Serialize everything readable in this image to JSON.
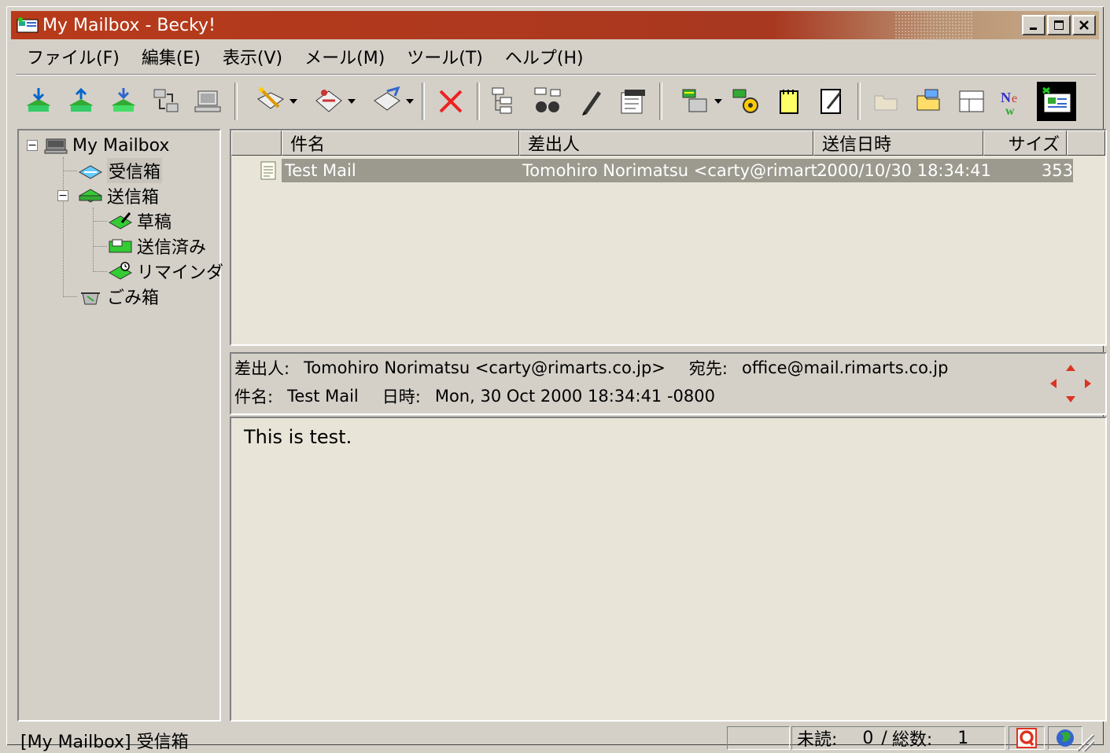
{
  "window": {
    "title": "My Mailbox - Becky!"
  },
  "menu": [
    "ファイル(F)",
    "編集(E)",
    "表示(V)",
    "メール(M)",
    "ツール(T)",
    "ヘルプ(H)"
  ],
  "tree": {
    "root": "My Mailbox",
    "inbox": "受信箱",
    "outbox": "送信箱",
    "drafts": "草稿",
    "sent": "送信済み",
    "reminder": "リマインダ",
    "trash": "ごみ箱"
  },
  "list": {
    "columns": [
      "件名",
      "差出人",
      "送信日時",
      "サイズ"
    ],
    "rows": [
      {
        "subject": "Test Mail",
        "from": "Tomohiro Norimatsu <carty@rimart...",
        "date": "2000/10/30 18:34:41",
        "size": "353"
      }
    ]
  },
  "header": {
    "from_label": "差出人:",
    "from_value": "Tomohiro Norimatsu <carty@rimarts.co.jp>",
    "to_label": "宛先:",
    "to_value": "office@mail.rimarts.co.jp",
    "subject_label": "件名:",
    "subject_value": "Test Mail",
    "date_label": "日時:",
    "date_value": "Mon, 30 Oct 2000 18:34:41 -0800"
  },
  "body": {
    "text": "This is test."
  },
  "status": {
    "location": "[My Mailbox] 受信箱",
    "unread_label": "未読:",
    "unread_value": "0",
    "separator": "/",
    "total_label": "総数:",
    "total_value": "1"
  },
  "colors": {
    "title_bar": "#b83a1a",
    "selection": "#9c9a8e",
    "pane_bg": "#e8e4d8"
  }
}
